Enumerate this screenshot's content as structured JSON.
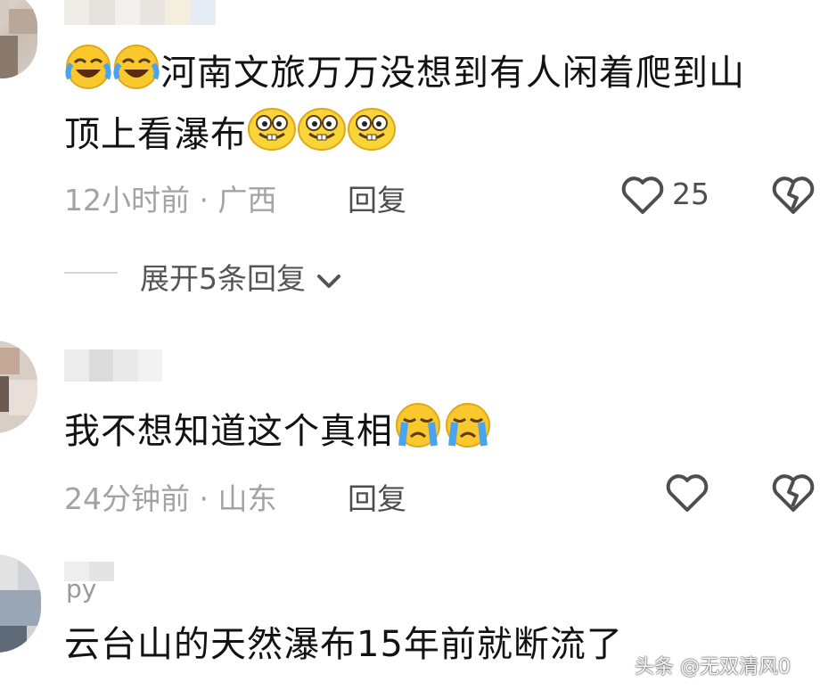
{
  "comments": [
    {
      "text_line1": "河南文旅万万没想到有人闲着爬到山",
      "text_line2": "顶上看瀑布",
      "time": "12小时前",
      "location": "广西",
      "reply_label": "回复",
      "like_count": "25",
      "expand_label": "展开5条回复",
      "lead_emoji": "laughing-crying-emoji",
      "trail_emoji": "grinning-face-emoji"
    },
    {
      "text": "我不想知道这个真相",
      "time": "24分钟前",
      "location": "山东",
      "reply_label": "回复",
      "trail_emoji": "crying-face-emoji"
    },
    {
      "username_visible": "py",
      "text": "云台山的天然瀑布15年前就断流了"
    }
  ],
  "separator": "·",
  "watermark": "头条 @无双清风0",
  "colors": {
    "text": "#121212",
    "meta": "#a3a3a3",
    "action": "#4e4e4e",
    "emoji_yellow": "#f9c82d"
  }
}
